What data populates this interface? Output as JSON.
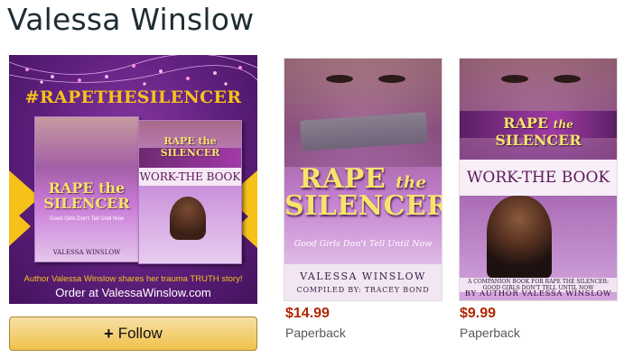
{
  "author": {
    "name": "Valessa Winslow"
  },
  "promo": {
    "hashtag": "#RAPETHESILENCER",
    "caption": "Author Valessa Winslow shares her trauma TRUTH story!",
    "order_text": "Order at ValessaWinslow.com",
    "mini_book_1": {
      "title_line1": "RAPE the",
      "title_line2": "SILENCER",
      "subtitle": "Good Girls Don't Tell Until Now",
      "author": "VALESSA WINSLOW"
    },
    "mini_book_2": {
      "title": "RAPE the SILENCER",
      "work": "WORK-THE BOOK"
    },
    "colors": {
      "background": "#5e1f7d",
      "accent": "#f7c21b"
    }
  },
  "follow_button": {
    "plus": "+",
    "label": "Follow"
  },
  "books": [
    {
      "title_line1": "RAPE",
      "title_the": "the",
      "title_line2": "SILENCER",
      "subtitle": "Good Girls Don't Tell Until Now",
      "author": "VALESSA WINSLOW",
      "compiled_by": "COMPILED BY: TRACEY BOND",
      "price": "$14.99",
      "format": "Paperback"
    },
    {
      "title_rape": "RAPE",
      "title_the": "the",
      "title_silencer": "SILENCER",
      "work_title": "WORK-THE BOOK",
      "blurb": "A COMPANION BOOK FOR RAPE THE SILENCER: GOOD GIRLS DON'T TELL UNTIL NOW",
      "byline": "BY AUTHOR VALESSA WINSLOW",
      "price": "$9.99",
      "format": "Paperback"
    }
  ],
  "colors": {
    "price": "#b12704",
    "button": "#f0c14b",
    "title_text": "#1f2d33"
  }
}
